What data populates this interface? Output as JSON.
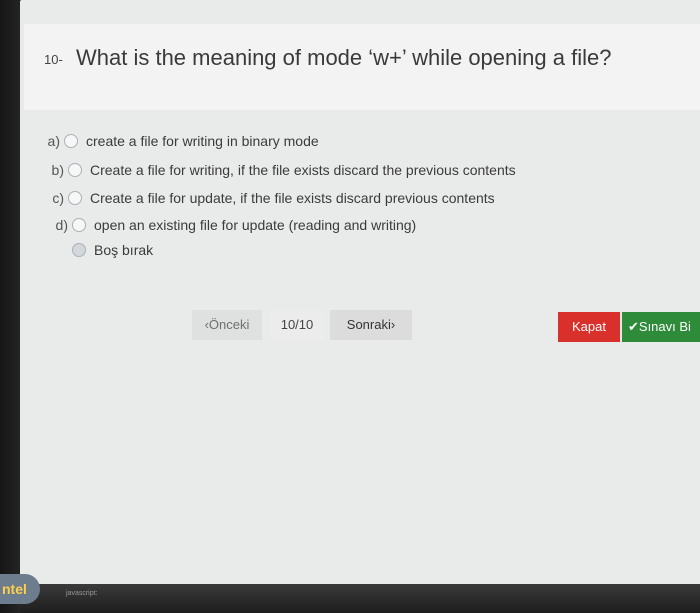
{
  "question": {
    "number": "10-",
    "text": "What is the meaning of mode ‘w+’ while opening a file?"
  },
  "options": [
    {
      "letter": "a)",
      "label": "create a file for writing in binary mode"
    },
    {
      "letter": "b)",
      "label": "Create a file for writing, if the file exists discard the previous contents"
    },
    {
      "letter": "c)",
      "label": "Create a file for update, if the file exists discard previous contents"
    },
    {
      "letter": "d)",
      "label": "open an existing file for update (reading and writing)"
    },
    {
      "letter": "",
      "label": "Boş bırak"
    }
  ],
  "nav": {
    "prev_label": "‹Önceki",
    "page_indicator": "10/10",
    "next_label": "Sonraki›",
    "close_label": "Kapat",
    "finish_label": "✔Sınavı Bi"
  },
  "status": {
    "text": "javascript:"
  },
  "sticker": {
    "text": "ntel"
  },
  "colors": {
    "close": "#d9302b",
    "finish": "#2e8b3a"
  }
}
